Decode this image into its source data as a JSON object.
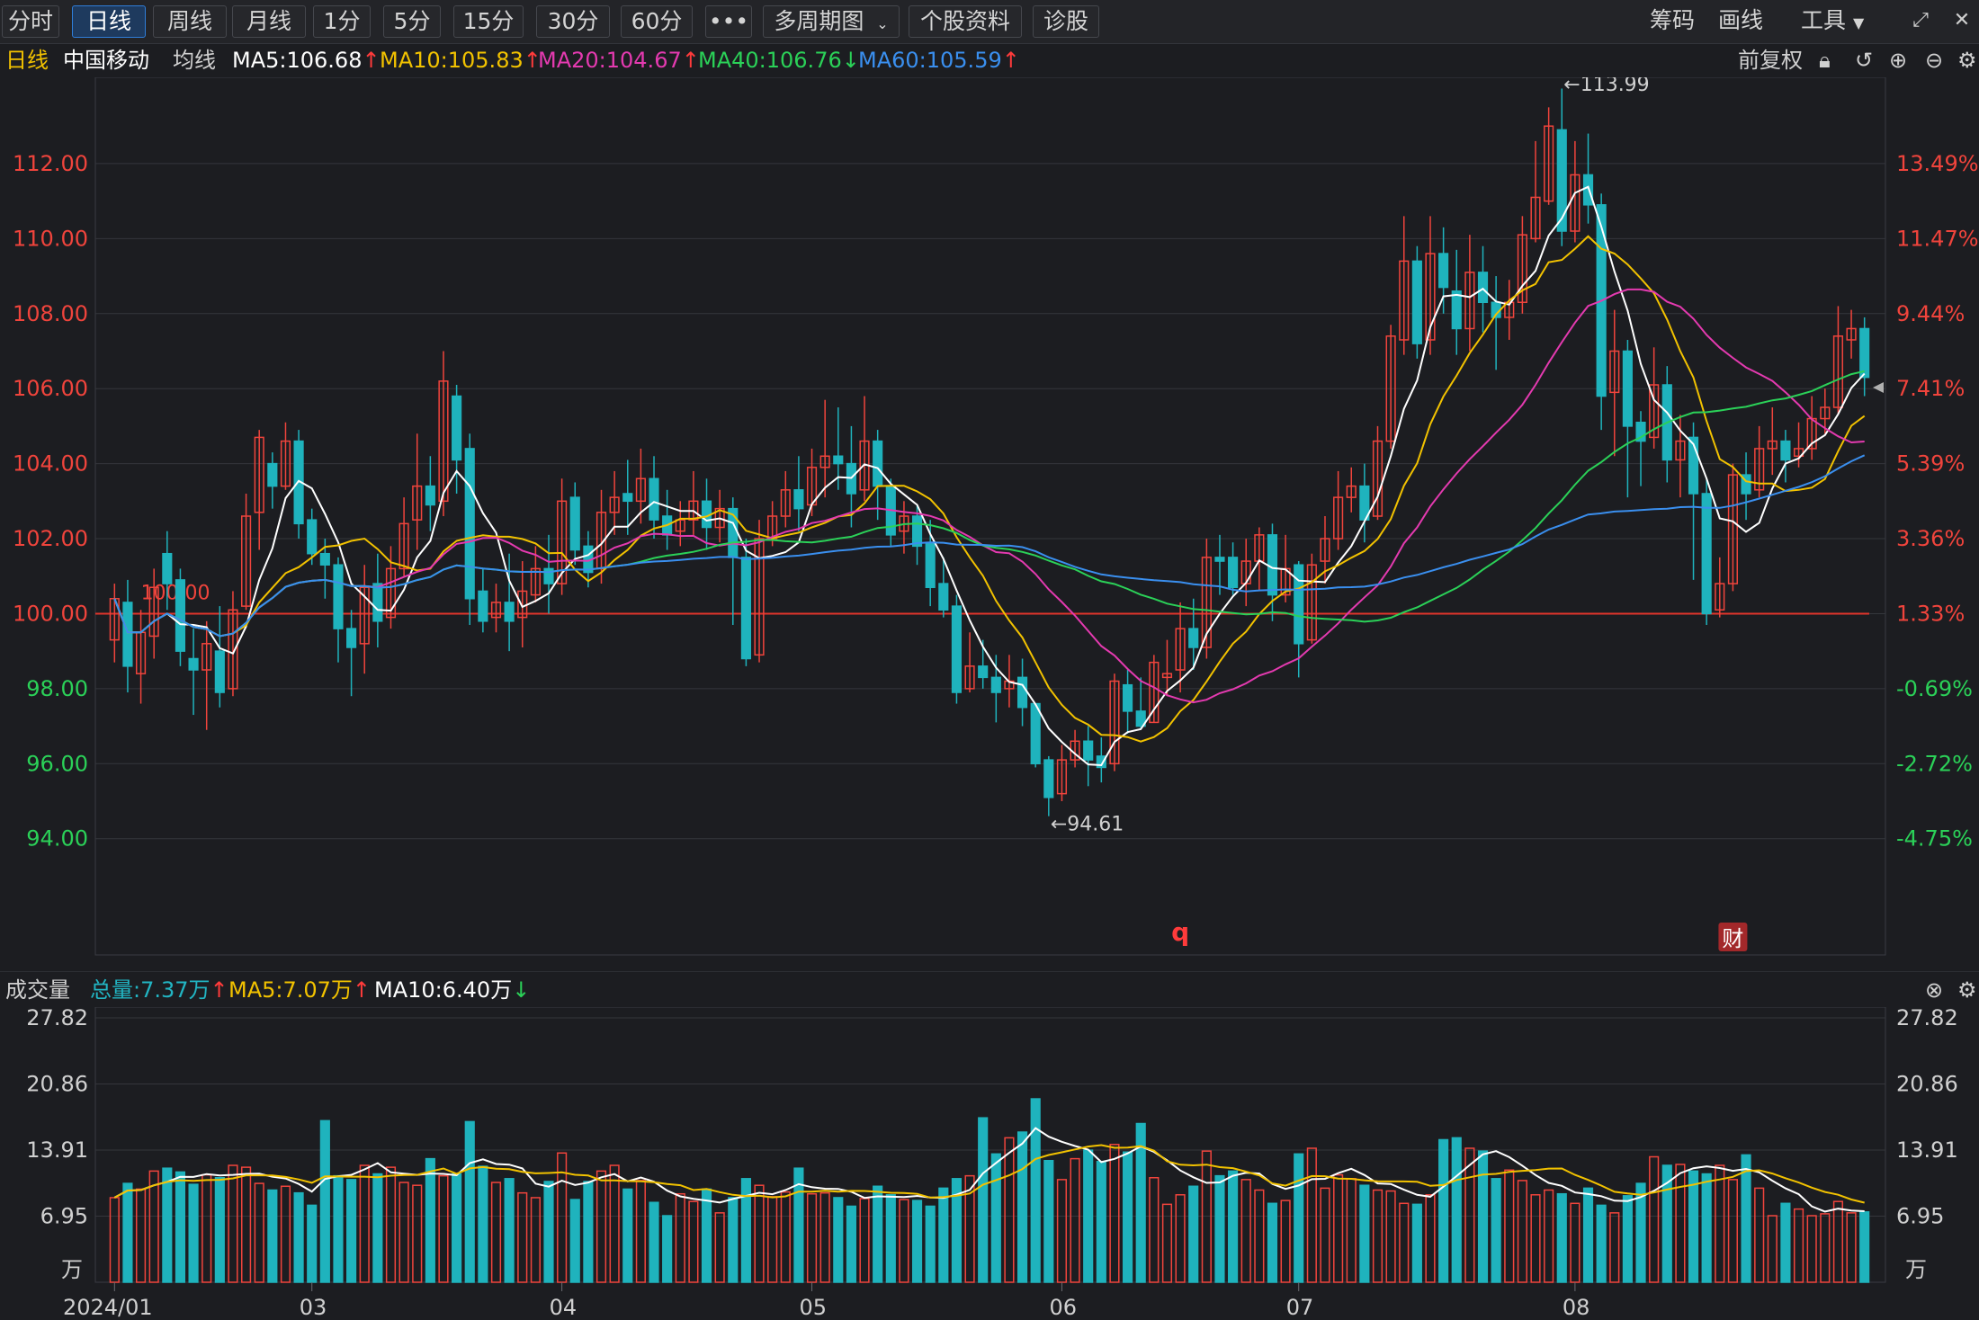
{
  "toolbar": {
    "tabs": [
      "分时",
      "日线",
      "周线",
      "月线",
      "1分",
      "5分",
      "15分",
      "30分",
      "60分",
      "•••",
      "多周期图",
      "个股资料",
      "诊股"
    ],
    "active_tab": "日线",
    "right_items": [
      "筹码",
      "画线",
      "工具"
    ],
    "dropdown_tab": "多周期图",
    "dropdown_right": "工具"
  },
  "legend": {
    "period": "日线",
    "stock_name": "中国移动",
    "ma_label": "均线",
    "adjust": "前复权",
    "ma": [
      {
        "label": "MA5:106.68",
        "color": "#ffffff",
        "dir": "up"
      },
      {
        "label": "MA10:105.83",
        "color": "#f2c200",
        "dir": "up"
      },
      {
        "label": "MA20:104.67",
        "color": "#e43ab0",
        "dir": "up"
      },
      {
        "label": "MA40:106.76",
        "color": "#2bd158",
        "dir": "down"
      },
      {
        "label": "MA60:105.59",
        "color": "#3a8fef",
        "dir": "up"
      }
    ]
  },
  "volume_legend": {
    "title": "成交量",
    "total": "总量:7.37万",
    "ma5": "MA5:7.07万",
    "ma10": "MA10:6.40万",
    "total_color": "#22b5c3",
    "ma5_color": "#f2c200",
    "ma10_color": "#ffffff"
  },
  "colors": {
    "up": "#f0443c",
    "down": "#1fb3bd",
    "ref_line": "#e0352b",
    "grid": "#34363c",
    "axis_text_up": "#f0443c",
    "axis_text_down": "#2bd158",
    "ma5": "#ffffff",
    "ma10": "#f2c200",
    "ma20": "#e43ab0",
    "ma40": "#2bd158",
    "ma60": "#3a8fef"
  },
  "chart_data": {
    "type": "candlestick",
    "price_ticks": [
      "112.00",
      "110.00",
      "108.00",
      "106.00",
      "104.00",
      "102.00",
      "100.00",
      "98.00",
      "96.00",
      "94.00"
    ],
    "percent_ticks": [
      "13.49%",
      "11.47%",
      "9.44%",
      "7.41%",
      "5.39%",
      "3.36%",
      "1.33%",
      "-0.69%",
      "-2.72%",
      "-4.75%"
    ],
    "ylim": [
      90.9,
      114.3
    ],
    "reference_price": 100.0,
    "reference_label": "100.00",
    "high_label": "←113.99",
    "low_label": "←94.61",
    "high_value": 113.99,
    "low_value": 94.61,
    "markers": [
      {
        "date_index": 81,
        "text": "q"
      },
      {
        "date_index": 123,
        "text": "财"
      }
    ],
    "volume_ticks": [
      "27.82",
      "20.86",
      "13.91",
      "6.95"
    ],
    "volume_unit": "万",
    "volume_ylim": [
      0,
      27.82
    ],
    "x_labels": [
      {
        "index": 0,
        "text": "2024/01"
      },
      {
        "index": 15,
        "text": "03"
      },
      {
        "index": 34,
        "text": "04"
      },
      {
        "index": 53,
        "text": "05"
      },
      {
        "index": 72,
        "text": "06"
      },
      {
        "index": 90,
        "text": "07"
      },
      {
        "index": 111,
        "text": "08"
      }
    ],
    "ohlc": [
      [
        99.3,
        100.4,
        98.7,
        100.8
      ],
      [
        100.3,
        98.6,
        97.9,
        100.9
      ],
      [
        98.4,
        99.5,
        97.6,
        100.1
      ],
      [
        99.4,
        100.7,
        98.8,
        101.2
      ],
      [
        101.6,
        100.8,
        100.1,
        102.2
      ],
      [
        100.9,
        99.0,
        98.6,
        101.2
      ],
      [
        98.8,
        98.5,
        97.3,
        99.6
      ],
      [
        98.5,
        99.2,
        96.9,
        99.8
      ],
      [
        99.0,
        97.9,
        97.5,
        100.2
      ],
      [
        98.0,
        100.1,
        97.8,
        100.6
      ],
      [
        100.2,
        102.6,
        100.1,
        103.2
      ],
      [
        102.7,
        104.7,
        101.7,
        104.9
      ],
      [
        104.0,
        103.4,
        102.8,
        104.3
      ],
      [
        103.4,
        104.6,
        103.3,
        105.1
      ],
      [
        104.6,
        102.4,
        102.0,
        104.9
      ],
      [
        102.5,
        101.6,
        101.3,
        102.8
      ],
      [
        101.6,
        101.3,
        100.4,
        102.0
      ],
      [
        101.3,
        99.6,
        98.7,
        101.5
      ],
      [
        99.6,
        99.1,
        97.8,
        100.1
      ],
      [
        99.2,
        100.7,
        98.4,
        101.3
      ],
      [
        100.8,
        99.8,
        99.1,
        101.6
      ],
      [
        99.9,
        101.2,
        99.6,
        101.8
      ],
      [
        101.2,
        102.4,
        101.0,
        103.1
      ],
      [
        102.5,
        103.4,
        101.7,
        104.8
      ],
      [
        103.4,
        102.9,
        102.2,
        104.2
      ],
      [
        103.0,
        106.2,
        102.6,
        107.0
      ],
      [
        105.8,
        104.1,
        103.2,
        106.1
      ],
      [
        104.4,
        100.4,
        99.7,
        104.8
      ],
      [
        100.6,
        99.8,
        99.5,
        101.2
      ],
      [
        99.9,
        100.3,
        99.5,
        100.8
      ],
      [
        100.3,
        99.8,
        99.0,
        101.6
      ],
      [
        99.9,
        100.6,
        99.1,
        101.4
      ],
      [
        100.5,
        101.2,
        100.3,
        101.8
      ],
      [
        101.2,
        100.8,
        100.0,
        102.1
      ],
      [
        100.8,
        103.0,
        100.5,
        103.6
      ],
      [
        103.1,
        101.7,
        101.3,
        103.5
      ],
      [
        101.8,
        101.1,
        100.7,
        102.2
      ],
      [
        101.2,
        102.7,
        100.8,
        103.3
      ],
      [
        102.7,
        103.1,
        102.1,
        103.8
      ],
      [
        103.2,
        103.0,
        102.1,
        104.1
      ],
      [
        103.0,
        103.6,
        102.4,
        104.4
      ],
      [
        103.6,
        102.5,
        102.0,
        104.2
      ],
      [
        102.6,
        102.1,
        101.7,
        103.3
      ],
      [
        102.2,
        102.5,
        101.8,
        103.0
      ],
      [
        102.5,
        103.0,
        102.1,
        103.8
      ],
      [
        103.0,
        102.3,
        101.7,
        103.6
      ],
      [
        102.3,
        102.8,
        101.9,
        103.3
      ],
      [
        102.8,
        101.5,
        99.7,
        103.1
      ],
      [
        101.5,
        98.8,
        98.6,
        102.0
      ],
      [
        98.9,
        102.0,
        98.7,
        102.5
      ],
      [
        102.0,
        102.6,
        101.8,
        103.0
      ],
      [
        102.6,
        103.3,
        102.3,
        103.8
      ],
      [
        103.3,
        102.8,
        102.2,
        104.2
      ],
      [
        102.9,
        103.9,
        102.6,
        104.4
      ],
      [
        103.9,
        104.2,
        103.1,
        105.7
      ],
      [
        104.2,
        104.0,
        103.3,
        105.5
      ],
      [
        104.0,
        103.2,
        102.3,
        105.0
      ],
      [
        103.3,
        104.6,
        103.0,
        105.8
      ],
      [
        104.6,
        103.4,
        102.5,
        104.9
      ],
      [
        103.4,
        102.1,
        101.8,
        103.6
      ],
      [
        102.2,
        102.6,
        101.6,
        103.0
      ],
      [
        102.6,
        101.8,
        101.3,
        102.9
      ],
      [
        101.9,
        100.7,
        100.2,
        102.5
      ],
      [
        100.8,
        100.1,
        99.9,
        101.5
      ],
      [
        100.2,
        97.9,
        97.6,
        100.5
      ],
      [
        98.0,
        98.6,
        97.9,
        99.5
      ],
      [
        98.6,
        98.3,
        98.0,
        99.3
      ],
      [
        98.3,
        97.9,
        97.1,
        98.9
      ],
      [
        98.0,
        98.2,
        97.5,
        98.9
      ],
      [
        98.3,
        97.5,
        97.0,
        98.8
      ],
      [
        97.6,
        96.0,
        95.9,
        97.6
      ],
      [
        96.1,
        95.1,
        94.6,
        96.2
      ],
      [
        95.2,
        96.1,
        95.0,
        96.5
      ],
      [
        96.1,
        96.6,
        95.9,
        96.9
      ],
      [
        96.6,
        96.1,
        95.4,
        97.0
      ],
      [
        96.2,
        95.9,
        95.5,
        96.7
      ],
      [
        96.0,
        98.2,
        95.8,
        98.4
      ],
      [
        98.1,
        97.4,
        96.8,
        98.5
      ],
      [
        97.4,
        97.0,
        96.9,
        98.3
      ],
      [
        97.1,
        98.7,
        97.1,
        98.9
      ],
      [
        98.3,
        98.4,
        97.8,
        99.3
      ],
      [
        98.5,
        99.6,
        97.9,
        100.3
      ],
      [
        99.6,
        99.1,
        98.5,
        100.4
      ],
      [
        99.1,
        101.5,
        98.8,
        102.0
      ],
      [
        101.5,
        101.4,
        100.5,
        102.1
      ],
      [
        101.5,
        100.7,
        100.5,
        101.9
      ],
      [
        100.8,
        101.4,
        100.2,
        102.0
      ],
      [
        101.4,
        102.1,
        100.6,
        102.3
      ],
      [
        102.1,
        100.5,
        99.8,
        102.4
      ],
      [
        100.5,
        101.2,
        100.3,
        102.1
      ],
      [
        101.3,
        99.2,
        98.3,
        101.4
      ],
      [
        99.3,
        101.3,
        99.2,
        101.6
      ],
      [
        101.4,
        102.0,
        100.8,
        102.6
      ],
      [
        102.0,
        103.1,
        101.7,
        103.8
      ],
      [
        103.1,
        103.4,
        102.7,
        103.9
      ],
      [
        103.4,
        102.5,
        101.9,
        104.0
      ],
      [
        102.6,
        104.6,
        102.5,
        105.0
      ],
      [
        104.6,
        107.4,
        104.4,
        107.7
      ],
      [
        107.3,
        109.4,
        106.9,
        110.6
      ],
      [
        109.4,
        107.2,
        106.8,
        109.8
      ],
      [
        107.3,
        109.6,
        106.9,
        110.6
      ],
      [
        109.6,
        108.7,
        108.0,
        110.3
      ],
      [
        108.6,
        107.6,
        106.9,
        109.7
      ],
      [
        107.6,
        109.1,
        107.0,
        110.1
      ],
      [
        109.1,
        108.3,
        107.5,
        109.8
      ],
      [
        108.3,
        107.9,
        106.5,
        109.0
      ],
      [
        107.9,
        108.3,
        107.3,
        108.9
      ],
      [
        108.3,
        110.1,
        108.0,
        110.6
      ],
      [
        110.0,
        111.1,
        109.9,
        112.6
      ],
      [
        111.0,
        113.0,
        110.9,
        113.5
      ],
      [
        112.9,
        110.2,
        109.8,
        114.0
      ],
      [
        110.2,
        111.7,
        109.9,
        112.6
      ],
      [
        111.7,
        110.9,
        110.4,
        112.8
      ],
      [
        110.9,
        105.8,
        104.9,
        111.2
      ],
      [
        105.9,
        107.0,
        104.2,
        108.1
      ],
      [
        107.0,
        105.0,
        103.1,
        107.3
      ],
      [
        105.1,
        104.6,
        103.4,
        105.4
      ],
      [
        104.7,
        106.1,
        104.4,
        107.1
      ],
      [
        106.1,
        104.1,
        103.5,
        106.6
      ],
      [
        104.1,
        104.6,
        103.1,
        105.3
      ],
      [
        104.7,
        103.2,
        100.9,
        105.1
      ],
      [
        103.2,
        100.0,
        99.7,
        103.6
      ],
      [
        100.1,
        100.8,
        99.9,
        101.5
      ],
      [
        100.8,
        103.7,
        100.6,
        104.0
      ],
      [
        103.7,
        103.2,
        102.5,
        104.3
      ],
      [
        103.3,
        104.4,
        103.1,
        105.0
      ],
      [
        104.4,
        104.6,
        103.7,
        105.5
      ],
      [
        104.6,
        104.1,
        103.5,
        104.9
      ],
      [
        104.2,
        104.4,
        103.9,
        105.1
      ],
      [
        104.4,
        105.2,
        104.1,
        105.8
      ],
      [
        105.2,
        105.5,
        104.8,
        106.0
      ],
      [
        105.5,
        107.4,
        105.3,
        108.2
      ],
      [
        107.3,
        107.6,
        106.8,
        108.1
      ],
      [
        107.6,
        106.3,
        105.8,
        107.9
      ]
    ],
    "volume": [
      8.9,
      10.4,
      9.8,
      11.7,
      12.0,
      11.6,
      10.3,
      11.3,
      11.0,
      12.3,
      12.1,
      10.4,
      9.7,
      10.1,
      9.4,
      8.1,
      17.0,
      11.2,
      10.8,
      12.3,
      11.4,
      12.1,
      10.5,
      10.2,
      13.0,
      11.2,
      11.4,
      16.9,
      12.2,
      10.5,
      10.9,
      9.4,
      8.9,
      10.6,
      13.6,
      8.7,
      10.6,
      11.7,
      12.3,
      9.8,
      10.7,
      8.4,
      7.0,
      9.3,
      8.5,
      9.8,
      7.3,
      8.9,
      10.9,
      10.2,
      9.0,
      9.5,
      12.0,
      9.3,
      9.4,
      8.9,
      8.0,
      8.8,
      10.1,
      9.2,
      8.7,
      8.6,
      8.0,
      9.9,
      10.9,
      11.2,
      17.3,
      13.5,
      15.2,
      15.8,
      19.3,
      12.8,
      10.8,
      13.0,
      13.9,
      12.7,
      14.5,
      13.7,
      16.7,
      11.0,
      8.2,
      9.2,
      10.1,
      13.8,
      11.2,
      11.7,
      10.8,
      9.7,
      8.3,
      8.6,
      13.5,
      14.1,
      9.9,
      11.3,
      10.9,
      10.2,
      9.7,
      9.6,
      8.3,
      8.2,
      9.2,
      15.0,
      15.2,
      14.1,
      13.8,
      10.9,
      11.8,
      10.7,
      9.2,
      9.7,
      9.3,
      8.3,
      9.9,
      8.1,
      7.3,
      9.1,
      10.4,
      13.2,
      12.3,
      12.4,
      11.7,
      11.4,
      12.3,
      10.8,
      13.4,
      9.9,
      7.0,
      8.3,
      7.7,
      7.0,
      7.2,
      8.5,
      7.3,
      7.4
    ]
  }
}
